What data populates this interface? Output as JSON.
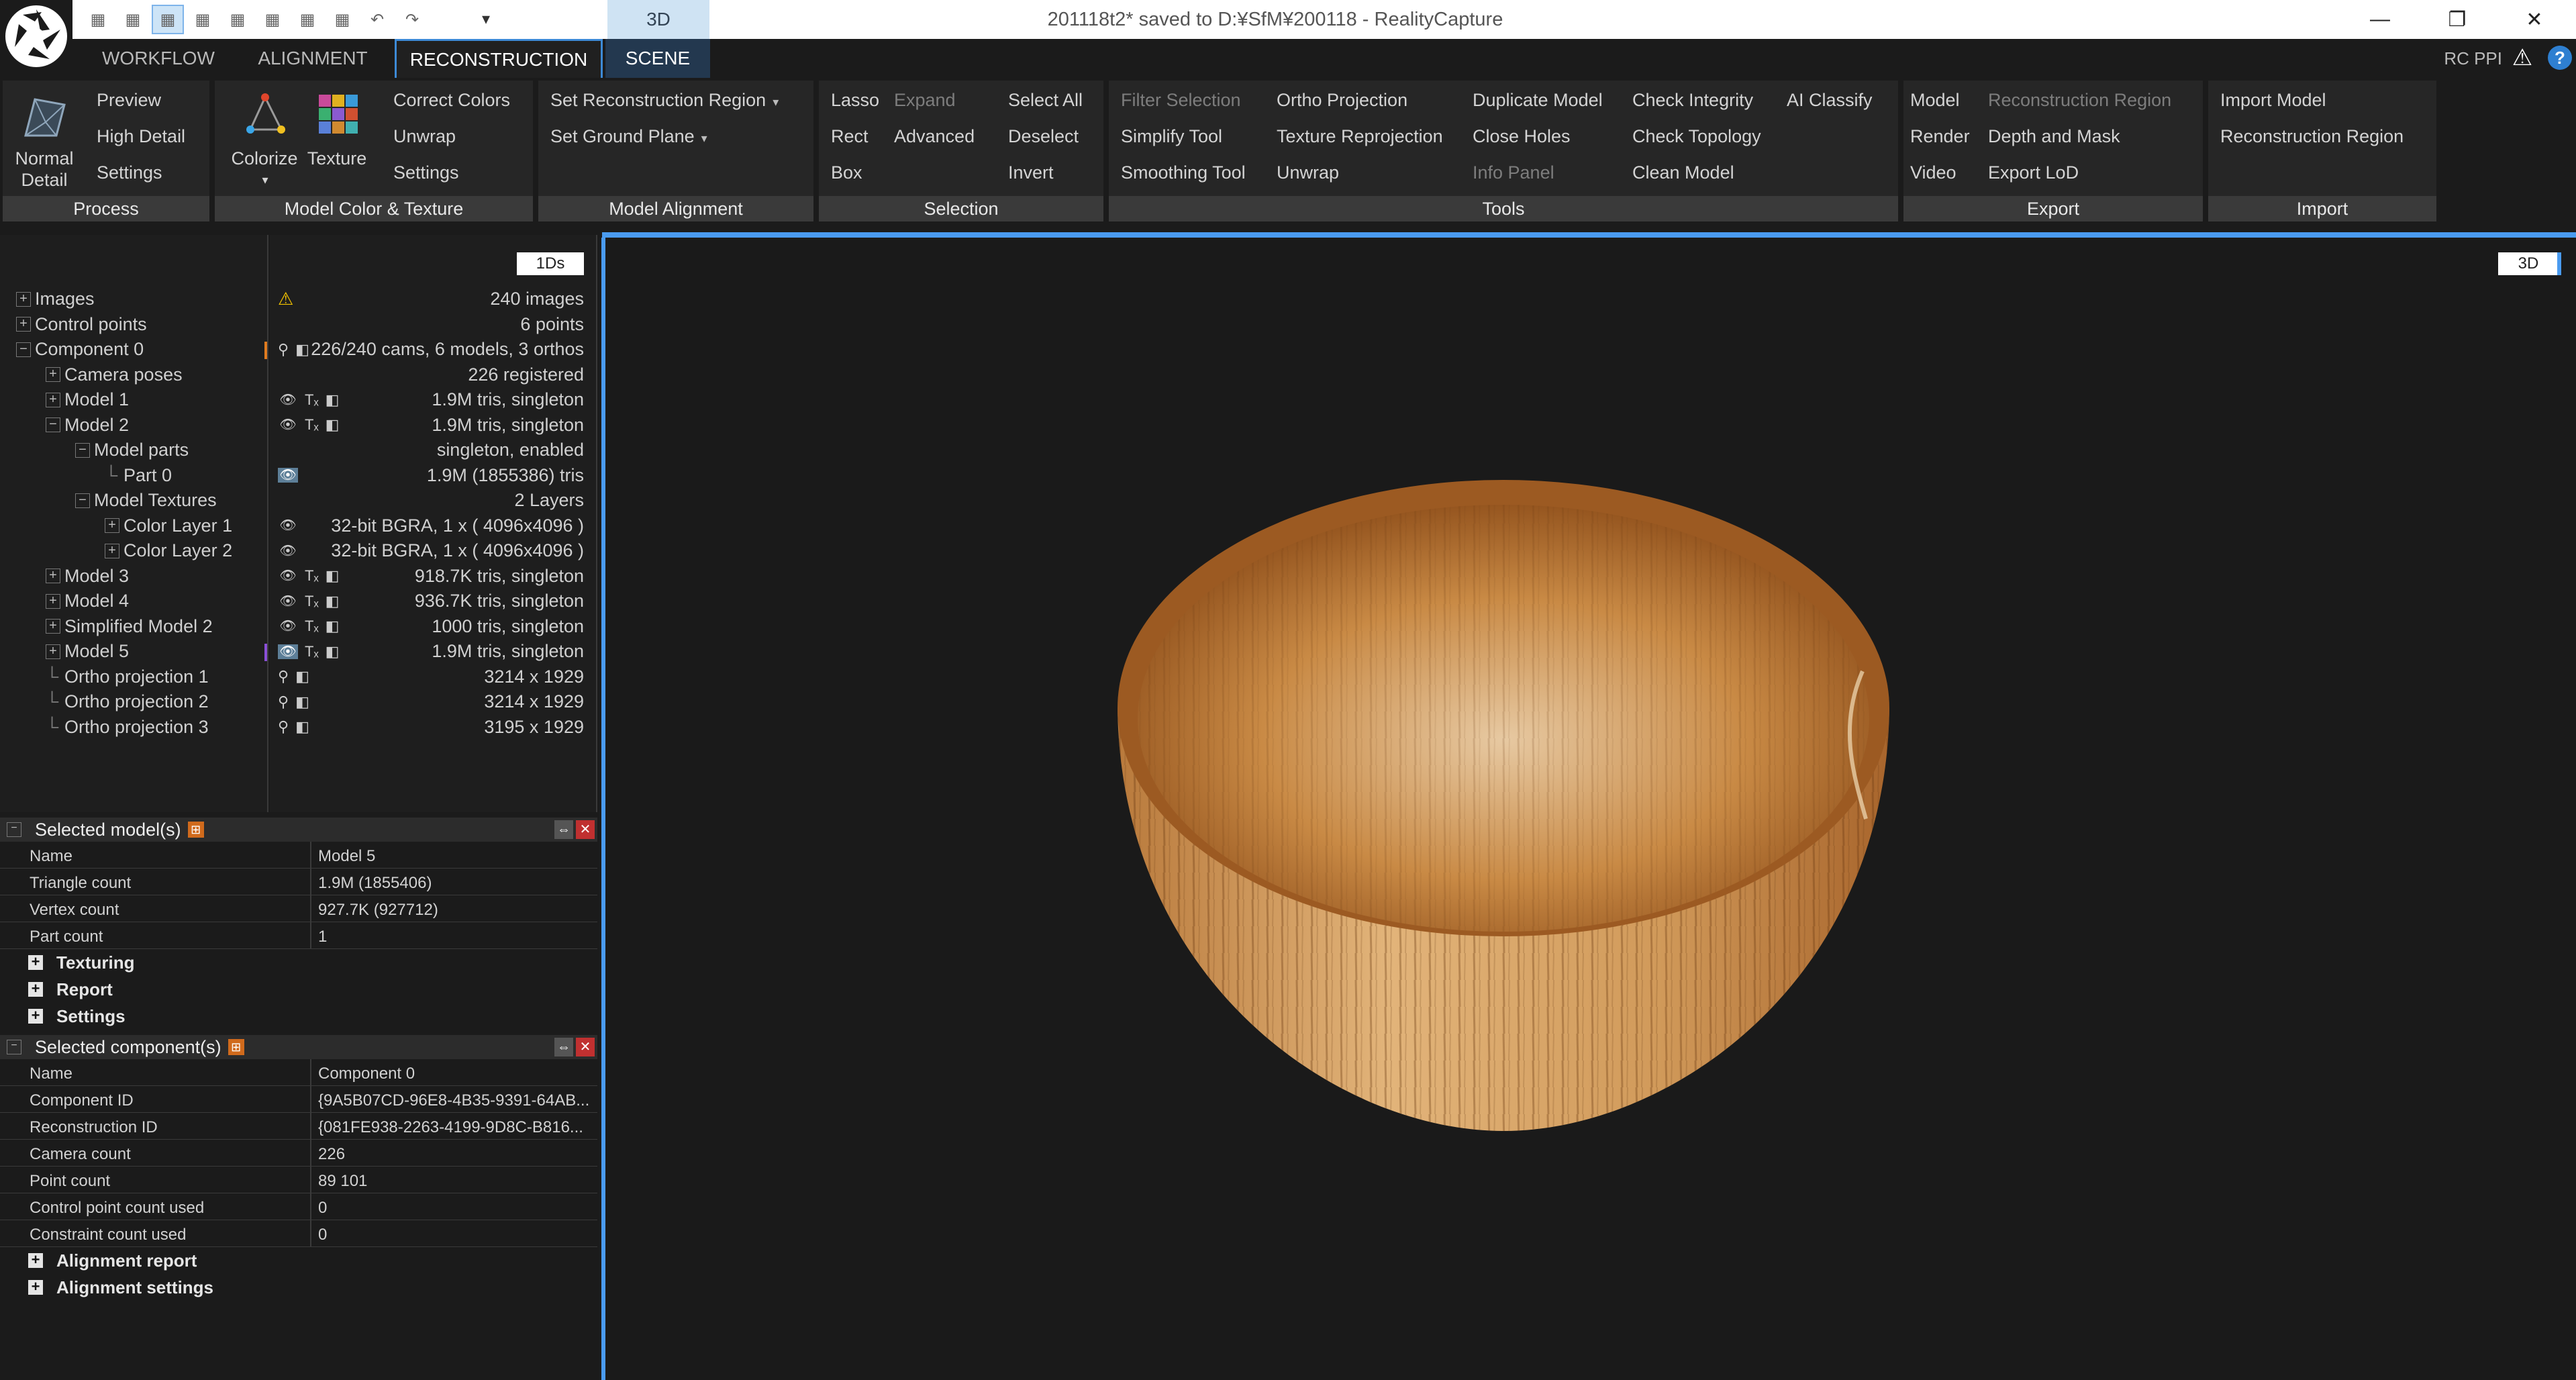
{
  "app": {
    "window_title": "201118t2* saved to D:¥SfM¥200118 - RealityCapture",
    "quick_tab": "3D",
    "window_buttons": {
      "minimize": "—",
      "restore": "❐",
      "close": "✕"
    },
    "rc_ppi": "RC PPI",
    "help": "?"
  },
  "quick_access": [
    "layout-1",
    "layout-2",
    "layout-3",
    "layout-4",
    "layout-5",
    "layout-6",
    "layout-7",
    "layout-8",
    "undo",
    "redo"
  ],
  "tabs": [
    "WORKFLOW",
    "ALIGNMENT",
    "RECONSTRUCTION",
    "SCENE"
  ],
  "ribbon": {
    "process": {
      "normal_detail": "Normal\nDetail",
      "preview": "Preview",
      "high_detail": "High Detail",
      "settings": "Settings",
      "footer": "Process"
    },
    "color_texture": {
      "colorize": "Colorize",
      "texture": "Texture",
      "correct_colors": "Correct Colors",
      "unwrap": "Unwrap",
      "settings": "Settings",
      "footer": "Model Color & Texture"
    },
    "alignment": {
      "set_reconstruction_region": "Set Reconstruction Region",
      "set_ground_plane": "Set Ground Plane",
      "footer": "Model Alignment"
    },
    "selection": {
      "lasso": "Lasso",
      "expand": "Expand",
      "select_all": "Select All",
      "rect": "Rect",
      "advanced": "Advanced",
      "deselect": "Deselect",
      "box": "Box",
      "invert": "Invert",
      "footer": "Selection"
    },
    "tools": {
      "filter_selection": "Filter Selection",
      "ortho_projection": "Ortho Projection",
      "duplicate_model": "Duplicate Model",
      "check_integrity": "Check Integrity",
      "ai_classify": "AI Classify",
      "simplify_tool": "Simplify Tool",
      "texture_reprojection": "Texture Reprojection",
      "close_holes": "Close Holes",
      "check_topology": "Check Topology",
      "smoothing_tool": "Smoothing Tool",
      "unwrap": "Unwrap",
      "info_panel": "Info Panel",
      "clean_model": "Clean Model",
      "footer": "Tools"
    },
    "export": {
      "model": "Model",
      "reconstruction_region": "Reconstruction Region",
      "render": "Render",
      "depth_and_mask": "Depth and Mask",
      "video": "Video",
      "export_lod": "Export LoD",
      "footer": "Export"
    },
    "import": {
      "import_model": "Import Model",
      "reconstruction_region": "Reconstruction Region",
      "footer": "Import"
    }
  },
  "panel_badges": {
    "left": "1Ds",
    "viewport": "3D"
  },
  "tree": [
    {
      "label": "Images",
      "info": "240 images",
      "depth": 0,
      "toggle": "+"
    },
    {
      "label": "Control points",
      "info": "6 points",
      "depth": 0,
      "toggle": "+"
    },
    {
      "label": "Component 0",
      "info": "226/240 cams, 6 models, 3 orthos",
      "depth": 0,
      "toggle": "−"
    },
    {
      "label": "Camera poses",
      "info": "226 registered",
      "depth": 1,
      "toggle": "+"
    },
    {
      "label": "Model 1",
      "info": "1.9M tris, singleton",
      "depth": 1,
      "toggle": "+"
    },
    {
      "label": "Model 2",
      "info": "1.9M tris, singleton",
      "depth": 1,
      "toggle": "−"
    },
    {
      "label": "Model parts",
      "info": "singleton, enabled",
      "depth": 2,
      "toggle": "−"
    },
    {
      "label": "Part 0",
      "info": "1.9M (1855386) tris",
      "depth": 3,
      "toggle": ""
    },
    {
      "label": "Model Textures",
      "info": "2 Layers",
      "depth": 2,
      "toggle": "−"
    },
    {
      "label": "Color Layer 1",
      "info": "32-bit BGRA, 1 x ( 4096x4096 )",
      "depth": 3,
      "toggle": "+"
    },
    {
      "label": "Color Layer 2",
      "info": "32-bit BGRA, 1 x ( 4096x4096 )",
      "depth": 3,
      "toggle": "+"
    },
    {
      "label": "Model 3",
      "info": "918.7K tris, singleton",
      "depth": 1,
      "toggle": "+"
    },
    {
      "label": "Model 4",
      "info": "936.7K tris, singleton",
      "depth": 1,
      "toggle": "+"
    },
    {
      "label": "Simplified Model 2",
      "info": "1000 tris, singleton",
      "depth": 1,
      "toggle": "+"
    },
    {
      "label": "Model 5",
      "info": "1.9M tris, singleton",
      "depth": 1,
      "toggle": "+"
    },
    {
      "label": "Ortho projection 1",
      "info": "3214 x 1929",
      "depth": 1,
      "toggle": ""
    },
    {
      "label": "Ortho projection 2",
      "info": "3214 x 1929",
      "depth": 1,
      "toggle": ""
    },
    {
      "label": "Ortho projection 3",
      "info": "3195 x 1929",
      "depth": 1,
      "toggle": ""
    }
  ],
  "tree_icon_glyphs": {
    "eye": "👁",
    "texture": "Tₓ",
    "frame": "◧",
    "pin": "⚲"
  },
  "selected_models": {
    "title": "Selected model(s)",
    "rows": [
      {
        "key": "Name",
        "value": "Model 5"
      },
      {
        "key": "Triangle count",
        "value": "1.9M (1855406)"
      },
      {
        "key": "Vertex count",
        "value": "927.7K (927712)"
      },
      {
        "key": "Part count",
        "value": "1"
      }
    ],
    "sections": [
      "Texturing",
      "Report",
      "Settings"
    ]
  },
  "selected_component": {
    "title": "Selected component(s)",
    "rows": [
      {
        "key": "Name",
        "value": "Component 0"
      },
      {
        "key": "Component ID",
        "value": "{9A5B07CD-96E8-4B35-9391-64AB..."
      },
      {
        "key": "Reconstruction ID",
        "value": "{081FE938-2263-4199-9D8C-B816..."
      },
      {
        "key": "Camera count",
        "value": "226"
      },
      {
        "key": "Point count",
        "value": "89 101"
      },
      {
        "key": "Control point count used",
        "value": "0"
      },
      {
        "key": "Constraint count used",
        "value": "0"
      }
    ],
    "sections": [
      "Alignment report",
      "Alignment settings"
    ]
  },
  "colors": {
    "accent": "#4a9bf0",
    "orange_marker": "#e07b1f",
    "purple_marker": "#8a4fd6",
    "bowl_light": "#d9a468",
    "bowl_dark": "#8a4a17"
  }
}
